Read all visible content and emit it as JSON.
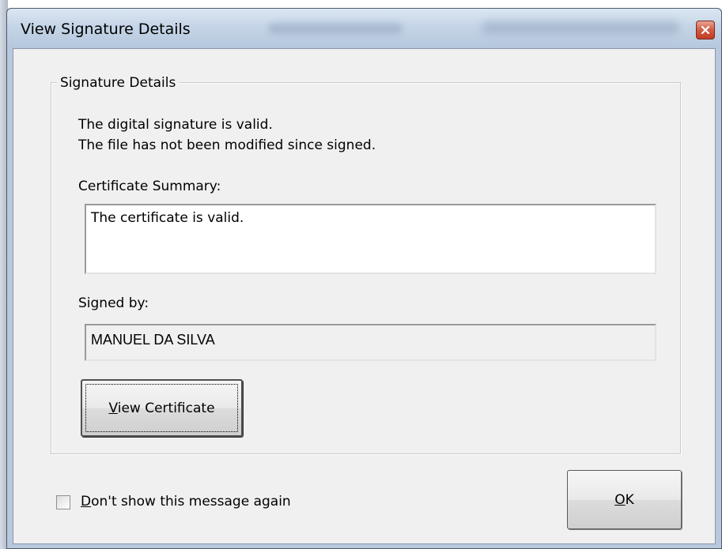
{
  "window": {
    "title": "View Signature Details"
  },
  "group": {
    "legend": "Signature Details"
  },
  "status": {
    "line1": "The digital signature is valid.",
    "line2": "The file has not been modified since signed."
  },
  "certificate_summary": {
    "label": "Certificate Summary:",
    "value": "The certificate is valid."
  },
  "signed_by": {
    "label": "Signed by:",
    "value": "MANUEL DA SILVA"
  },
  "buttons": {
    "view_certificate": {
      "mnemonic": "V",
      "rest": "iew Certificate"
    },
    "ok": {
      "mnemonic": "O",
      "rest": "K"
    }
  },
  "checkbox": {
    "mnemonic": "D",
    "rest": "on't show this message again",
    "checked": false
  },
  "icons": {
    "close": "close-icon"
  },
  "colors": {
    "close_button": "#c23b22",
    "dialog_background": "#f0f0f0",
    "titlebar": "#c5d5e7"
  }
}
